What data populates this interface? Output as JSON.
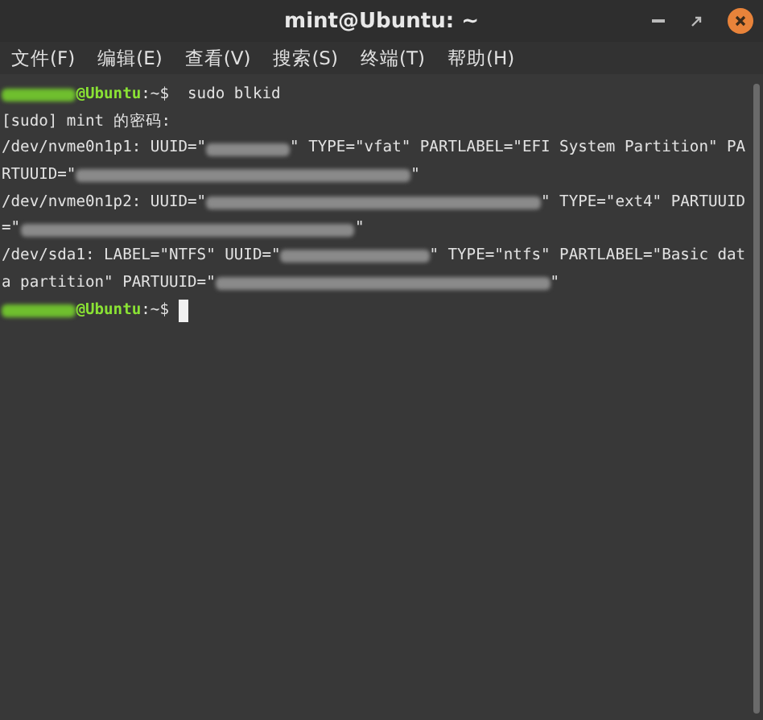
{
  "window": {
    "title": "mint@Ubuntu: ~"
  },
  "menu": [
    "文件(F)",
    "编辑(E)",
    "查看(V)",
    "搜索(S)",
    "终端(T)",
    "帮助(H)"
  ],
  "terminal": {
    "lines": [
      [
        {
          "kind": "redacted_user"
        },
        {
          "kind": "host",
          "text": "@Ubuntu"
        },
        {
          "kind": "text",
          "text": ":~$  sudo blkid"
        }
      ],
      [
        {
          "kind": "text",
          "text": "[sudo] mint 的密码:"
        }
      ],
      [
        {
          "kind": "text",
          "text": "/dev/nvme0n1p1: UUID=\""
        },
        {
          "kind": "redacted_short"
        },
        {
          "kind": "text",
          "text": "\" TYPE=\"vfat\" PARTLABEL=\"EFI System Partition\" PA"
        }
      ],
      [
        {
          "kind": "text",
          "text": "RTUUID=\""
        },
        {
          "kind": "redacted_long"
        },
        {
          "kind": "text",
          "text": "\""
        }
      ],
      [
        {
          "kind": "text",
          "text": "/dev/nvme0n1p2: UUID=\""
        },
        {
          "kind": "redacted_long"
        },
        {
          "kind": "text",
          "text": "\" TYPE=\"ext4\" PARTUUID"
        }
      ],
      [
        {
          "kind": "text",
          "text": "=\""
        },
        {
          "kind": "redacted_long"
        },
        {
          "kind": "text",
          "text": "\""
        }
      ],
      [
        {
          "kind": "text",
          "text": "/dev/sda1: LABEL=\"NTFS\" UUID=\""
        },
        {
          "kind": "redacted_medium"
        },
        {
          "kind": "text",
          "text": "\" TYPE=\"ntfs\" PARTLABEL=\"Basic dat"
        }
      ],
      [
        {
          "kind": "text",
          "text": "a partition\" PARTUUID=\""
        },
        {
          "kind": "redacted_long"
        },
        {
          "kind": "text",
          "text": "\""
        }
      ],
      [
        {
          "kind": "redacted_user"
        },
        {
          "kind": "host",
          "text": "@Ubuntu"
        },
        {
          "kind": "text",
          "text": ":~$ "
        },
        {
          "kind": "cursor"
        }
      ]
    ]
  }
}
